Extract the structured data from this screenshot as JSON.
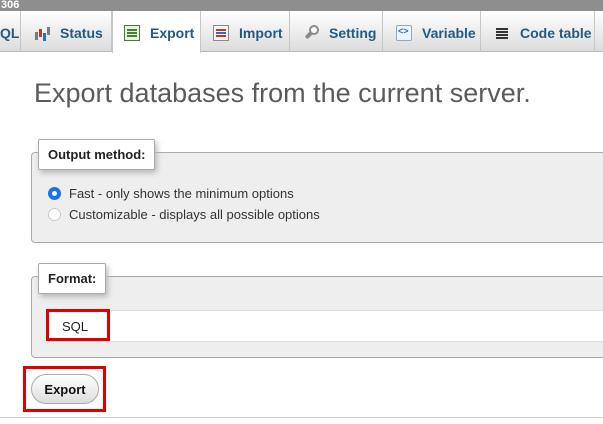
{
  "window": {
    "title_fragment": "306"
  },
  "tabs": [
    {
      "label": "QL",
      "icon": "sql-icon",
      "active": false
    },
    {
      "label": "Status",
      "icon": "status-chart-icon",
      "active": false
    },
    {
      "label": "Export",
      "icon": "export-icon",
      "active": true
    },
    {
      "label": "Import",
      "icon": "import-icon",
      "active": false
    },
    {
      "label": "Setting",
      "icon": "wrench-icon",
      "active": false
    },
    {
      "label": "Variable",
      "icon": "variable-icon",
      "active": false
    },
    {
      "label": "Code table",
      "icon": "code-table-icon",
      "active": false
    }
  ],
  "page": {
    "title": "Export databases from the current server."
  },
  "output_method": {
    "legend": "Output method:",
    "options": [
      {
        "label": "Fast - only shows the minimum options",
        "checked": true
      },
      {
        "label": "Customizable - displays all possible options",
        "checked": false
      }
    ]
  },
  "format": {
    "legend": "Format:",
    "selected": "SQL"
  },
  "actions": {
    "export_label": "Export"
  },
  "colors": {
    "tab_text": "#235a81",
    "radio_accent": "#1a73e8",
    "highlight": "#e00000",
    "fieldset_bg": "#eeeeee"
  }
}
